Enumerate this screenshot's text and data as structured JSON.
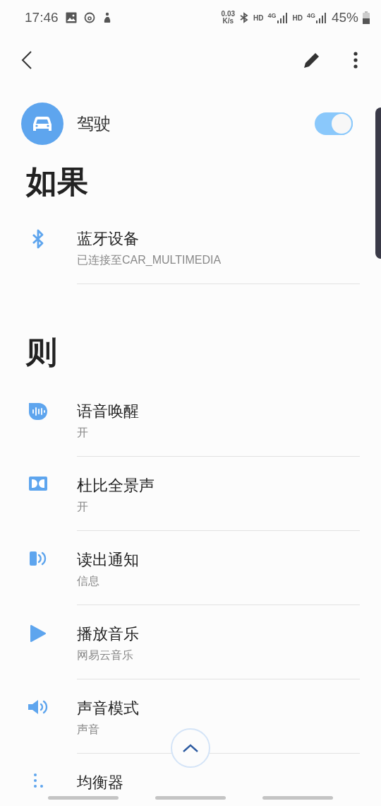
{
  "status_bar": {
    "time": "17:46",
    "speed": "0.03",
    "speed_unit": "K/s",
    "sim1_hd": "HD",
    "sim1_net": "4G",
    "sim2_hd": "HD",
    "sim2_net": "4G",
    "battery": "45%"
  },
  "header": {
    "title": "驾驶",
    "enabled": true
  },
  "if_section": {
    "heading": "如果",
    "items": [
      {
        "kind": "bluetooth",
        "title": "蓝牙设备",
        "subtitle": "已连接至CAR_MULTIMEDIA"
      }
    ]
  },
  "then_section": {
    "heading": "则",
    "items": [
      {
        "kind": "voice",
        "title": "语音唤醒",
        "subtitle": "开"
      },
      {
        "kind": "dolby",
        "title": "杜比全景声",
        "subtitle": "开"
      },
      {
        "kind": "notify",
        "title": "读出通知",
        "subtitle": "信息"
      },
      {
        "kind": "play",
        "title": "播放音乐",
        "subtitle": "网易云音乐"
      },
      {
        "kind": "sound",
        "title": "声音模式",
        "subtitle": "声音"
      },
      {
        "kind": "equalizer",
        "title": "均衡器"
      }
    ]
  }
}
